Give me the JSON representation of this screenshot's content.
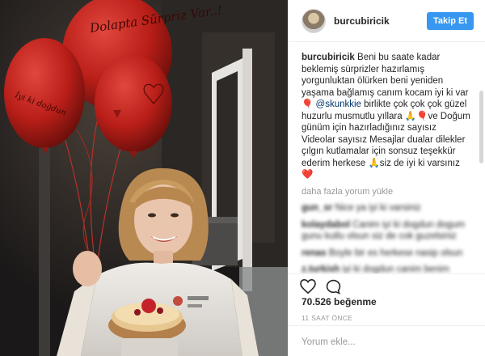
{
  "post": {
    "username": "burcubiricik",
    "follow_label": "Takip Et",
    "caption_user": "burcubiricik",
    "caption_part1": "Beni bu saate kadar beklemiş sürprizler hazırlamış yorgunluktan ölürken beni yeniden yaşama bağlamış canım kocam iyi ki var🎈",
    "mention": "@skunkkie",
    "caption_part2": " birlikte çok çok çok güzel huzurlu musmutlu yıllara 🙏🎈ve Doğum günüm için hazırladığınız sayısız Videolar sayısız Mesajlar dualar dilekler çılgın kutlamalar için sonsuz teşekkür ederim herkese 🙏siz de iyi ki varsınız ❤️",
    "more_comments": "daha fazla yorum yükle",
    "likes": "70.526 beğenme",
    "time": "11 SAAT ÖNCE",
    "comment_placeholder": "Yorum ekle..."
  },
  "blurred_comments": [
    {
      "user": "gun_sr",
      "text": "Nice ya iyi ki varsiniz"
    },
    {
      "user": "kolaydabol",
      "text": "Canim iyi ki dogdun dogum gunu kutlu olsun siz de cok guzelsiniz"
    },
    {
      "user": "renas",
      "text": "Boyle bir es herkese nasip olsun"
    },
    {
      "user": "z.turkish",
      "text": "iyi ki dogdun canim benim"
    }
  ],
  "balloon_text": {
    "top": "Dolapta Sürpriz Var..!",
    "left": "İyi ki doğdun",
    "cake_sign": "S"
  },
  "icons": [
    "heart-icon",
    "comment-icon"
  ],
  "colors": {
    "follow": "#3897f0",
    "balloon": "#c8251f",
    "mention": "#003569"
  }
}
